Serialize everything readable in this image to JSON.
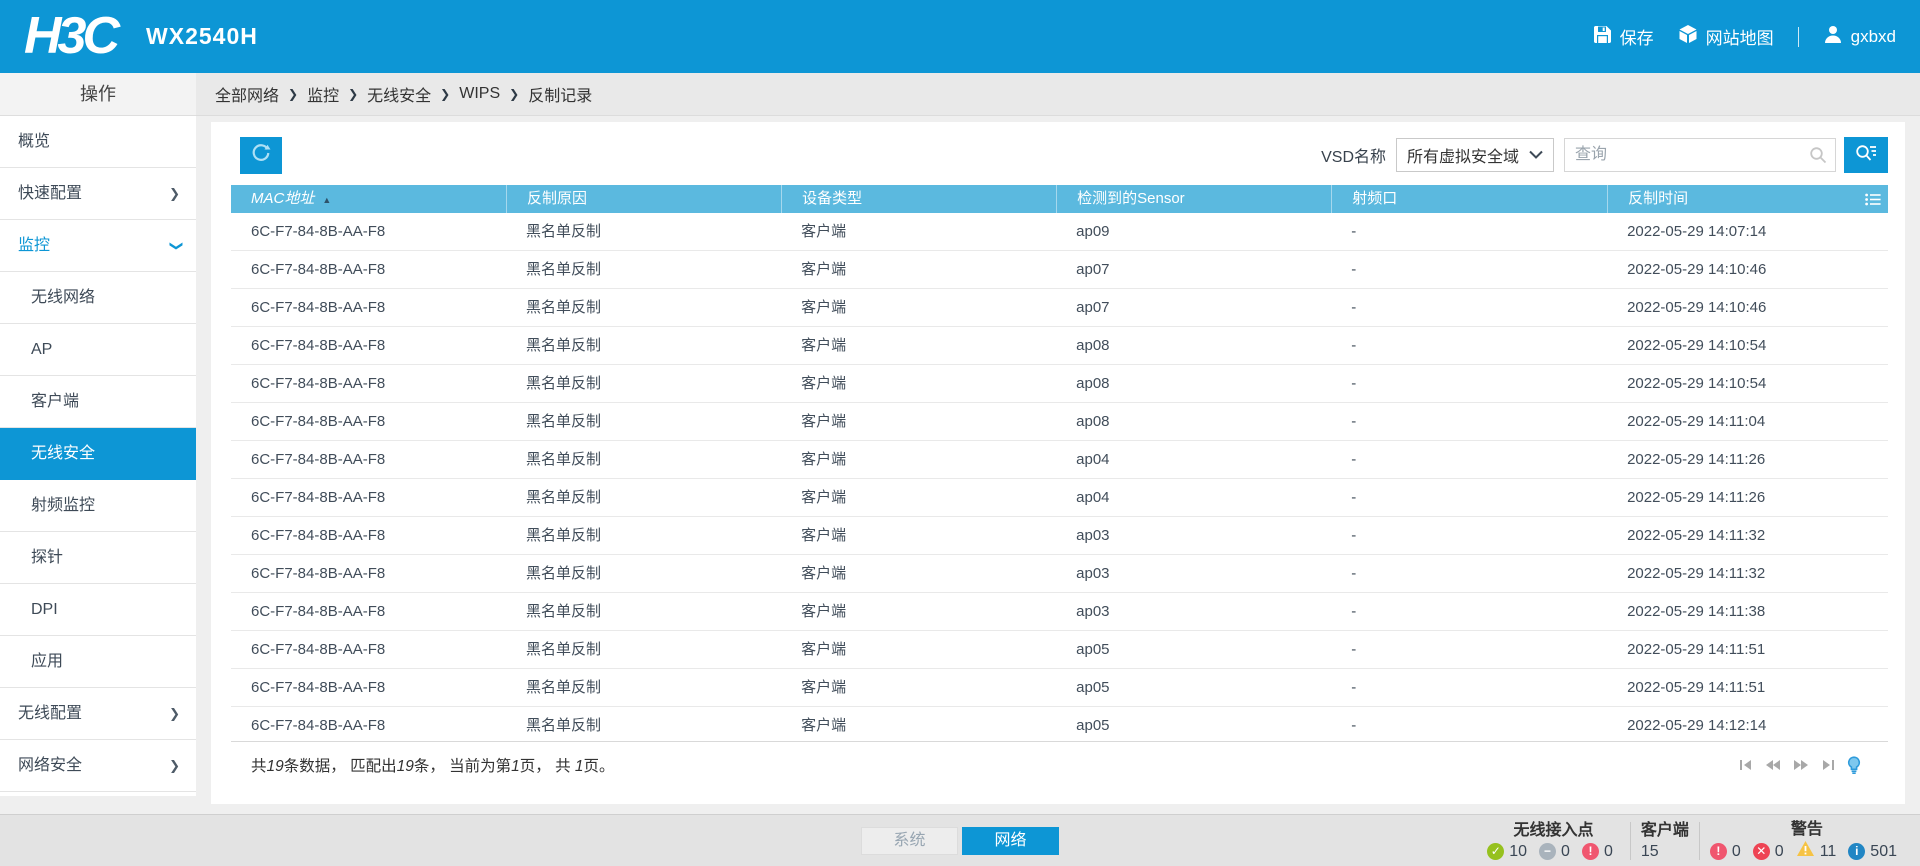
{
  "header": {
    "logo": "H3C",
    "model": "WX2540H",
    "save_label": "保存",
    "sitemap_label": "网站地图",
    "username": "gxbxd"
  },
  "breadcrumb": {
    "items": [
      "全部网络",
      "监控",
      "无线安全",
      "WIPS",
      "反制记录"
    ]
  },
  "sidebar": {
    "title": "操作",
    "items": [
      {
        "label": "概览",
        "name": "overview",
        "type": "top"
      },
      {
        "label": "快速配置",
        "name": "quick-setup",
        "type": "top",
        "chevron": "right"
      },
      {
        "label": "监控",
        "name": "monitoring",
        "type": "top",
        "chevron": "down",
        "expanded": true
      },
      {
        "label": "无线网络",
        "name": "wireless-network",
        "type": "sub"
      },
      {
        "label": "AP",
        "name": "ap",
        "type": "sub"
      },
      {
        "label": "客户端",
        "name": "client",
        "type": "sub"
      },
      {
        "label": "无线安全",
        "name": "wireless-security",
        "type": "sub",
        "selected": true
      },
      {
        "label": "射频监控",
        "name": "rf-monitoring",
        "type": "sub"
      },
      {
        "label": "探针",
        "name": "probe",
        "type": "sub"
      },
      {
        "label": "DPI",
        "name": "dpi",
        "type": "sub"
      },
      {
        "label": "应用",
        "name": "application",
        "type": "sub"
      },
      {
        "label": "无线配置",
        "name": "wireless-config",
        "type": "top",
        "chevron": "right"
      },
      {
        "label": "网络安全",
        "name": "network-security",
        "type": "top",
        "chevron": "right"
      }
    ]
  },
  "toolbar": {
    "vsd_label": "VSD名称",
    "vsd_value": "所有虚拟安全域",
    "search_placeholder": "查询"
  },
  "table": {
    "columns": [
      "MAC地址",
      "反制原因",
      "设备类型",
      "检测到的Sensor",
      "射频口",
      "反制时间"
    ],
    "sorted_column": 0,
    "sort_direction": "asc",
    "rows": [
      [
        "6C-F7-84-8B-AA-F8",
        "黑名单反制",
        "客户端",
        "ap09",
        "-",
        "2022-05-29 14:07:14"
      ],
      [
        "6C-F7-84-8B-AA-F8",
        "黑名单反制",
        "客户端",
        "ap07",
        "-",
        "2022-05-29 14:10:46"
      ],
      [
        "6C-F7-84-8B-AA-F8",
        "黑名单反制",
        "客户端",
        "ap07",
        "-",
        "2022-05-29 14:10:46"
      ],
      [
        "6C-F7-84-8B-AA-F8",
        "黑名单反制",
        "客户端",
        "ap08",
        "-",
        "2022-05-29 14:10:54"
      ],
      [
        "6C-F7-84-8B-AA-F8",
        "黑名单反制",
        "客户端",
        "ap08",
        "-",
        "2022-05-29 14:10:54"
      ],
      [
        "6C-F7-84-8B-AA-F8",
        "黑名单反制",
        "客户端",
        "ap08",
        "-",
        "2022-05-29 14:11:04"
      ],
      [
        "6C-F7-84-8B-AA-F8",
        "黑名单反制",
        "客户端",
        "ap04",
        "-",
        "2022-05-29 14:11:26"
      ],
      [
        "6C-F7-84-8B-AA-F8",
        "黑名单反制",
        "客户端",
        "ap04",
        "-",
        "2022-05-29 14:11:26"
      ],
      [
        "6C-F7-84-8B-AA-F8",
        "黑名单反制",
        "客户端",
        "ap03",
        "-",
        "2022-05-29 14:11:32"
      ],
      [
        "6C-F7-84-8B-AA-F8",
        "黑名单反制",
        "客户端",
        "ap03",
        "-",
        "2022-05-29 14:11:32"
      ],
      [
        "6C-F7-84-8B-AA-F8",
        "黑名单反制",
        "客户端",
        "ap03",
        "-",
        "2022-05-29 14:11:38"
      ],
      [
        "6C-F7-84-8B-AA-F8",
        "黑名单反制",
        "客户端",
        "ap05",
        "-",
        "2022-05-29 14:11:51"
      ],
      [
        "6C-F7-84-8B-AA-F8",
        "黑名单反制",
        "客户端",
        "ap05",
        "-",
        "2022-05-29 14:11:51"
      ],
      [
        "6C-F7-84-8B-AA-F8",
        "黑名单反制",
        "客户端",
        "ap05",
        "-",
        "2022-05-29 14:12:14"
      ]
    ]
  },
  "pagination": {
    "part1": "共",
    "total": "19",
    "part2": "条数据， 匹配出",
    "matched": "19",
    "part3": "条， 当前为第",
    "page": "1",
    "part4": "页， 共 ",
    "pages": "1",
    "part5": "页。"
  },
  "footer": {
    "tabs": [
      {
        "label": "系统",
        "name": "system",
        "active": false
      },
      {
        "label": "网络",
        "name": "network",
        "active": true
      }
    ],
    "stats": {
      "ap": {
        "label": "无线接入点",
        "ok": "10",
        "off": "0",
        "alert": "0"
      },
      "clients": {
        "label": "客户端",
        "count": "15"
      },
      "alarms": {
        "label": "警告",
        "critical": "0",
        "error": "0",
        "warning": "11",
        "info": "501"
      }
    }
  },
  "colors": {
    "accent": "#0D96D5",
    "table_header": "#5BB9DF",
    "status_ok": "#96C11E",
    "status_off": "#A9B3BC",
    "status_alert": "#F0566F",
    "status_error": "#EE4454",
    "status_warning": "#F6C344",
    "status_info": "#2186C4"
  }
}
